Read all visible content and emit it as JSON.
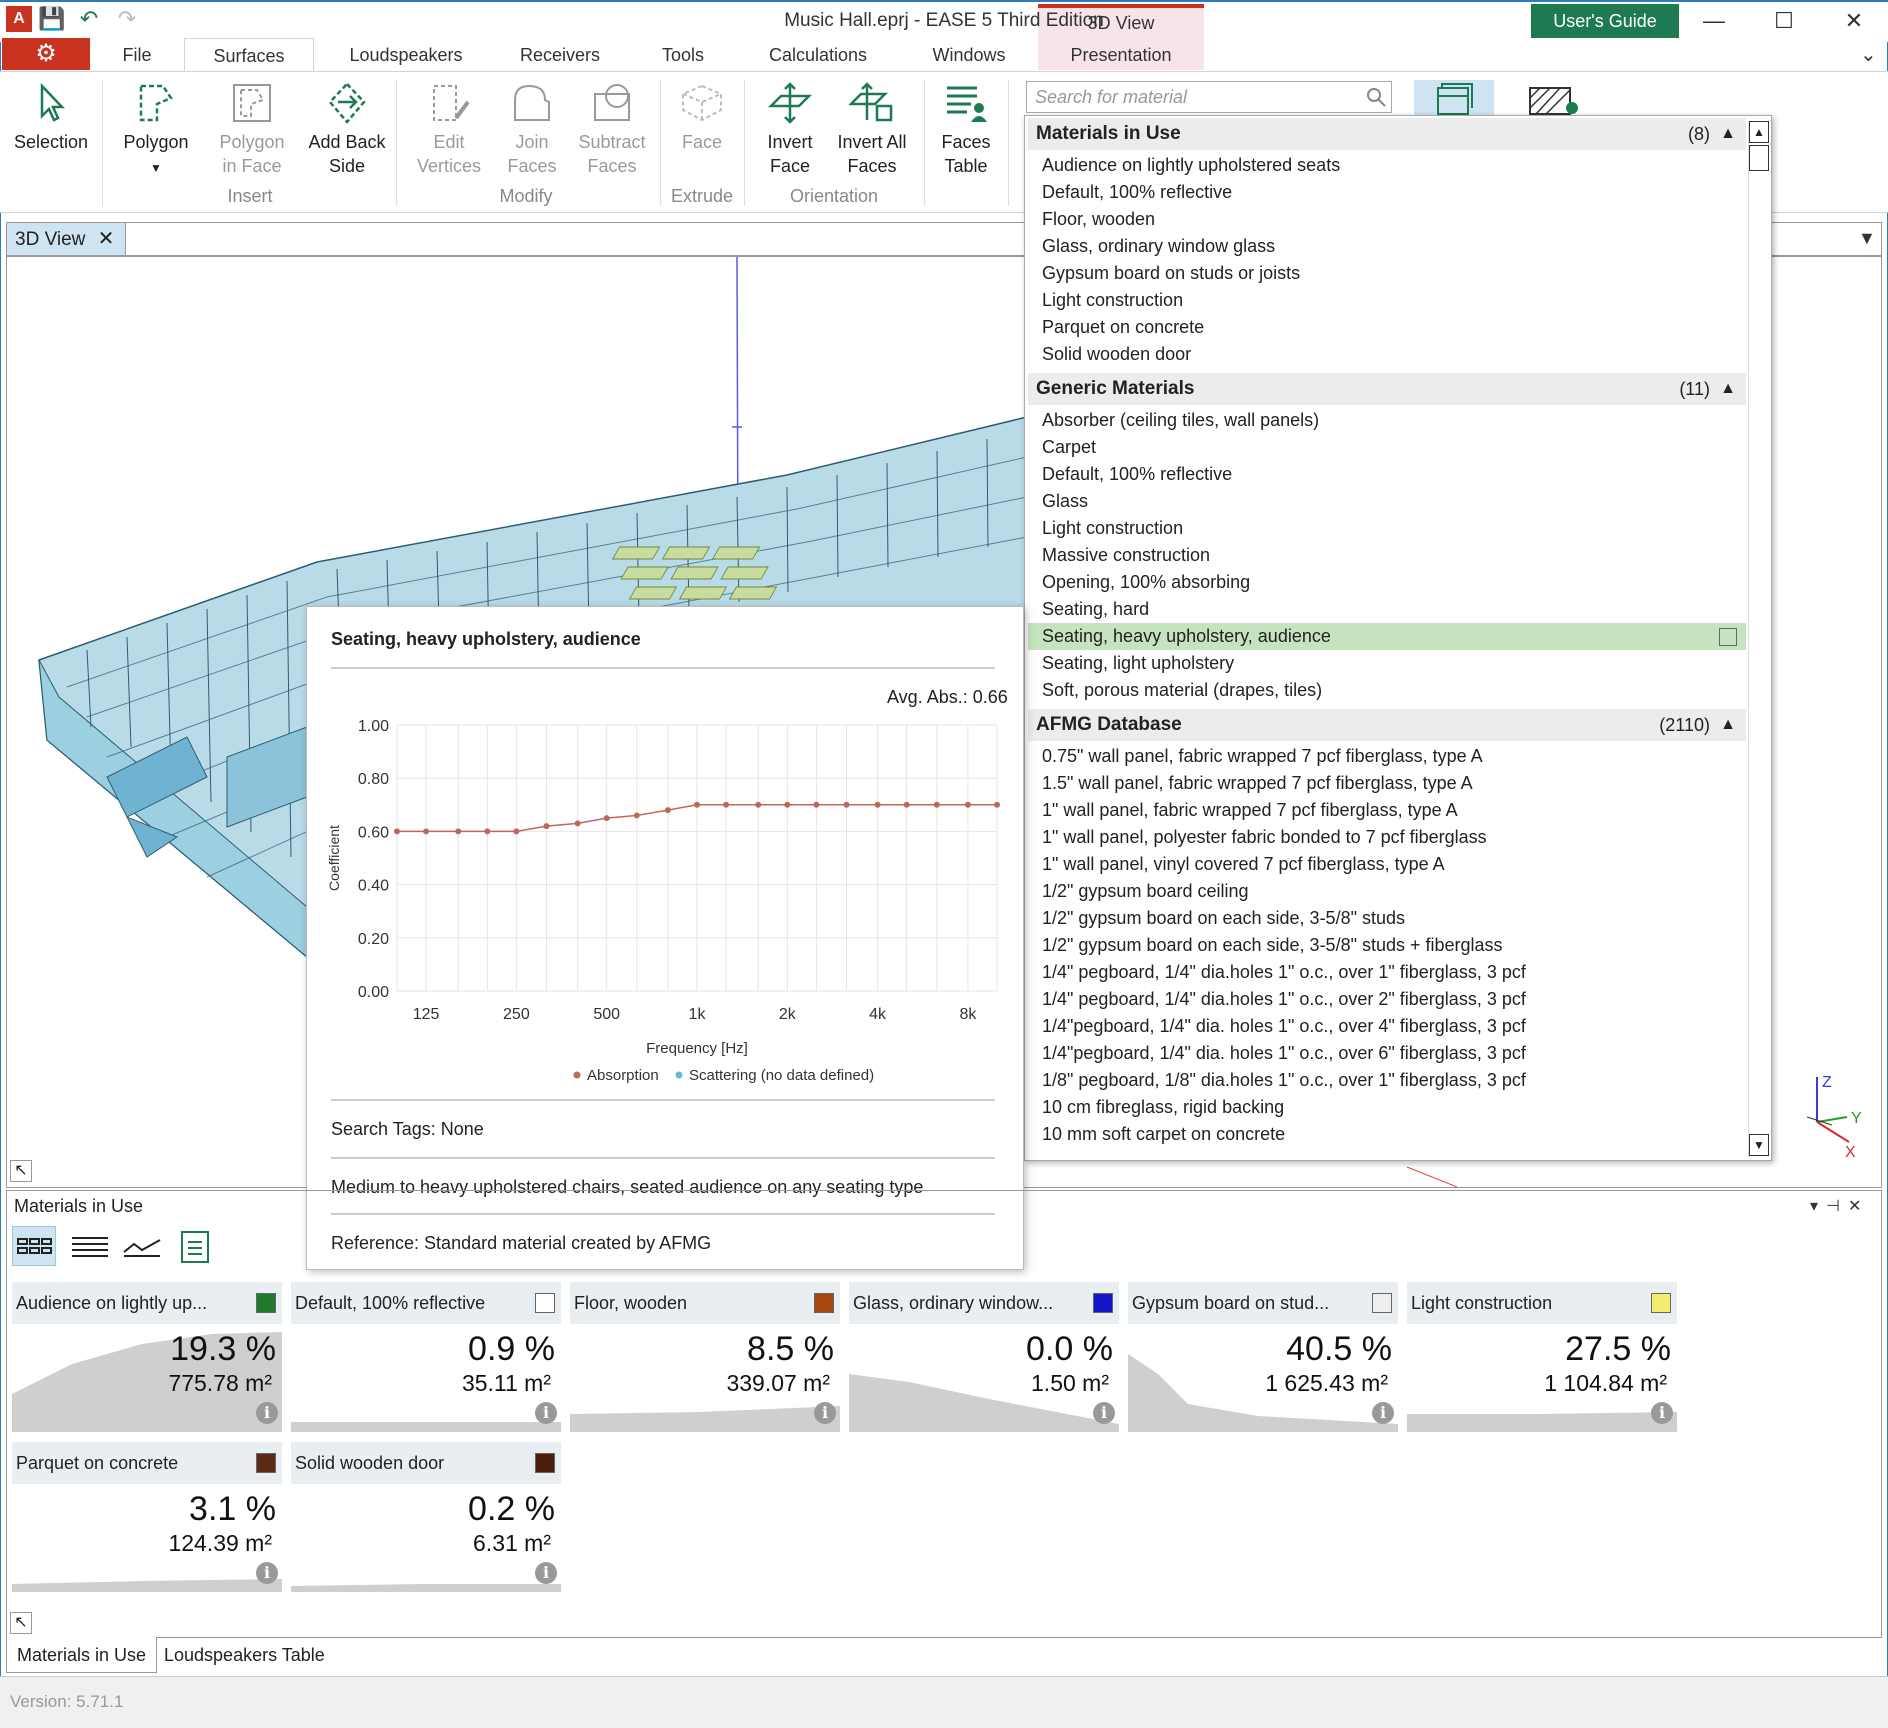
{
  "window": {
    "title": "Music Hall.eprj - EASE 5 Third Edition",
    "context_group": "3D View",
    "users_guide": "User's Guide"
  },
  "tabs": [
    "File",
    "Surfaces",
    "Loudspeakers",
    "Receivers",
    "Tools",
    "Calculations",
    "Windows",
    "Presentation"
  ],
  "ribbon": {
    "selection": "Selection",
    "polygon": "Polygon",
    "polygon_in_face_1": "Polygon",
    "polygon_in_face_2": "in Face",
    "add_back_1": "Add Back",
    "add_back_2": "Side",
    "edit_vertices_1": "Edit",
    "edit_vertices_2": "Vertices",
    "join_faces_1": "Join",
    "join_faces_2": "Faces",
    "subtract_faces_1": "Subtract",
    "subtract_faces_2": "Faces",
    "face": "Face",
    "invert_face_1": "Invert",
    "invert_face_2": "Face",
    "invert_all_1": "Invert All",
    "invert_all_2": "Faces",
    "faces_table_1": "Faces",
    "faces_table_2": "Table",
    "groups": {
      "insert": "Insert",
      "modify": "Modify",
      "extrude": "Extrude",
      "orientation": "Orientation"
    }
  },
  "search": {
    "placeholder": "Search for material"
  },
  "doc_tab": "3D View",
  "materials_list": {
    "in_use": {
      "title": "Materials in Use",
      "count": "(8)",
      "items": [
        "Audience on lightly upholstered seats",
        "Default, 100% reflective",
        "Floor, wooden",
        "Glass, ordinary window glass",
        "Gypsum board on studs or joists",
        "Light construction",
        "Parquet on concrete",
        "Solid wooden door"
      ]
    },
    "generic": {
      "title": "Generic Materials",
      "count": "(11)",
      "items": [
        "Absorber (ceiling tiles, wall panels)",
        "Carpet",
        "Default, 100% reflective",
        "Glass",
        "Light construction",
        "Massive construction",
        "Opening, 100% absorbing",
        "Seating, hard",
        "Seating, heavy upholstery, audience",
        "Seating, light upholstery",
        "Soft, porous material (drapes, tiles)"
      ]
    },
    "afmg": {
      "title": "AFMG Database",
      "count": "(2110)",
      "items": [
        "0.75\" wall panel, fabric wrapped 7 pcf fiberglass, type A",
        "1.5\" wall panel, fabric wrapped 7 pcf fiberglass, type A",
        "1\" wall panel, fabric wrapped 7 pcf fiberglass, type A",
        "1\" wall panel, polyester fabric bonded to 7 pcf fiberglass",
        "1\" wall panel, vinyl covered 7 pcf fiberglass, type A",
        "1/2\" gypsum board ceiling",
        "1/2\" gypsum board on each side, 3-5/8\" studs",
        "1/2\" gypsum board on each side, 3-5/8\" studs + fiberglass",
        "1/4\" pegboard, 1/4\" dia.holes 1\" o.c., over 1\" fiberglass, 3 pcf",
        "1/4\" pegboard, 1/4\" dia.holes 1\" o.c., over 2\" fiberglass, 3 pcf",
        "1/4\"pegboard, 1/4\" dia. holes 1\" o.c., over 4\" fiberglass, 3 pcf",
        "1/4\"pegboard, 1/4\" dia. holes 1\" o.c., over 6\" fiberglass, 3 pcf",
        "1/8\" pegboard, 1/8\" dia.holes 1\" o.c., over 1\" fiberglass, 3 pcf",
        "10 cm fibreglass, rigid backing",
        "10 mm soft carpet on concrete"
      ]
    }
  },
  "tooltip": {
    "title": "Seating, heavy upholstery, audience",
    "avg_abs": "Avg. Abs.: 0.66",
    "search_tags": "Search Tags: None",
    "description": "Medium to heavy upholstered chairs, seated audience on any seating type",
    "reference": "Reference: Standard material created by AFMG"
  },
  "chart_data": {
    "type": "line",
    "xlabel": "Frequency [Hz]",
    "ylabel": "Coefficient",
    "x_tick_labels": [
      "125",
      "250",
      "500",
      "1k",
      "2k",
      "4k",
      "8k"
    ],
    "y_tick_labels": [
      "0.00",
      "0.20",
      "0.40",
      "0.60",
      "0.80",
      "1.00"
    ],
    "ylim": [
      0,
      1
    ],
    "x": [
      100,
      125,
      160,
      200,
      250,
      315,
      400,
      500,
      630,
      800,
      1000,
      1250,
      1600,
      2000,
      2500,
      3150,
      4000,
      5000,
      6300,
      8000,
      10000
    ],
    "series": [
      {
        "name": "Absorption",
        "color": "#c0675c",
        "values": [
          0.6,
          0.6,
          0.6,
          0.6,
          0.6,
          0.62,
          0.63,
          0.65,
          0.66,
          0.68,
          0.7,
          0.7,
          0.7,
          0.7,
          0.7,
          0.7,
          0.7,
          0.7,
          0.7,
          0.7,
          0.7
        ]
      }
    ],
    "legend": [
      {
        "label": "Absorption",
        "color": "#c0675c"
      },
      {
        "label": "Scattering (no data defined)",
        "color": "#6ab6d8"
      }
    ],
    "legend_position": "bottom",
    "grid": true
  },
  "bottom_panel": {
    "title": "Materials in Use",
    "cards": [
      {
        "name": "Audience on lightly up...",
        "pct": "19.3 %",
        "area": "775.78 m²",
        "color": "#1f7a2a"
      },
      {
        "name": "Default, 100% reflective",
        "pct": "0.9 %",
        "area": "35.11 m²",
        "color": "#ffffff"
      },
      {
        "name": "Floor, wooden",
        "pct": "8.5 %",
        "area": "339.07 m²",
        "color": "#a4480f"
      },
      {
        "name": "Glass, ordinary window...",
        "pct": "0.0 %",
        "area": "1.50 m²",
        "color": "#1414c8"
      },
      {
        "name": "Gypsum board on stud...",
        "pct": "40.5 %",
        "area": "1 625.43 m²",
        "color": "#eeeeee"
      },
      {
        "name": "Light construction",
        "pct": "27.5 %",
        "area": "1 104.84 m²",
        "color": "#f3ec6e"
      },
      {
        "name": "Parquet on concrete",
        "pct": "3.1 %",
        "area": "124.39 m²",
        "color": "#5a2a12"
      },
      {
        "name": "Solid wooden door",
        "pct": "0.2 %",
        "area": "6.31 m²",
        "color": "#4a1e0a"
      }
    ]
  },
  "bottom_tabs": [
    "Materials in Use",
    "Loudspeakers Table"
  ],
  "axes_labels": {
    "z": "Z",
    "y": "Y",
    "x": "X"
  },
  "version": "Version: 5.71.1",
  "icon_glyphs": {
    "gear": "⚙",
    "save": "💾",
    "undo": "↶",
    "redo": "↷",
    "minimize": "—",
    "maximize": "☐",
    "close": "✕",
    "tab_close": "✕",
    "chevron_down": "⌄",
    "up_arrow": "▲",
    "down_arrow": "▼",
    "info": "i",
    "panel_controls": "▾⊣✕",
    "cursor": "↖"
  }
}
